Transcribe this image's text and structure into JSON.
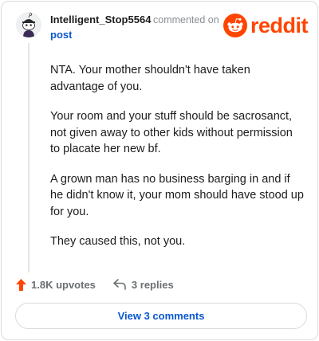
{
  "comment": {
    "username": "Intelligent_Stop5564",
    "action_text": "commented on",
    "target": "post",
    "paragraphs": [
      "NTA. Your mother shouldn't have taken advantage of you.",
      "Your room and your stuff should be sacrosanct, not given away to other kids without permission to placate her new bf.",
      "A grown man has no business barging in and if he didn't know it, your mom should have stood up for you.",
      "They caused this, not you."
    ]
  },
  "branding": {
    "logo_text": "reddit",
    "brand_color": "#ff4500",
    "logo_icon": "reddit-snoo-icon"
  },
  "stats": {
    "upvotes": "1.8K upvotes",
    "replies": "3 replies",
    "upvote_icon": "upvote-arrow-icon",
    "reply_icon": "reply-arrow-icon",
    "upvote_color": "#ff4500"
  },
  "footer": {
    "view_comments_label": "View 3 comments",
    "link_color": "#0a57d0"
  },
  "avatar": {
    "icon": "snoo-avatar-icon"
  }
}
